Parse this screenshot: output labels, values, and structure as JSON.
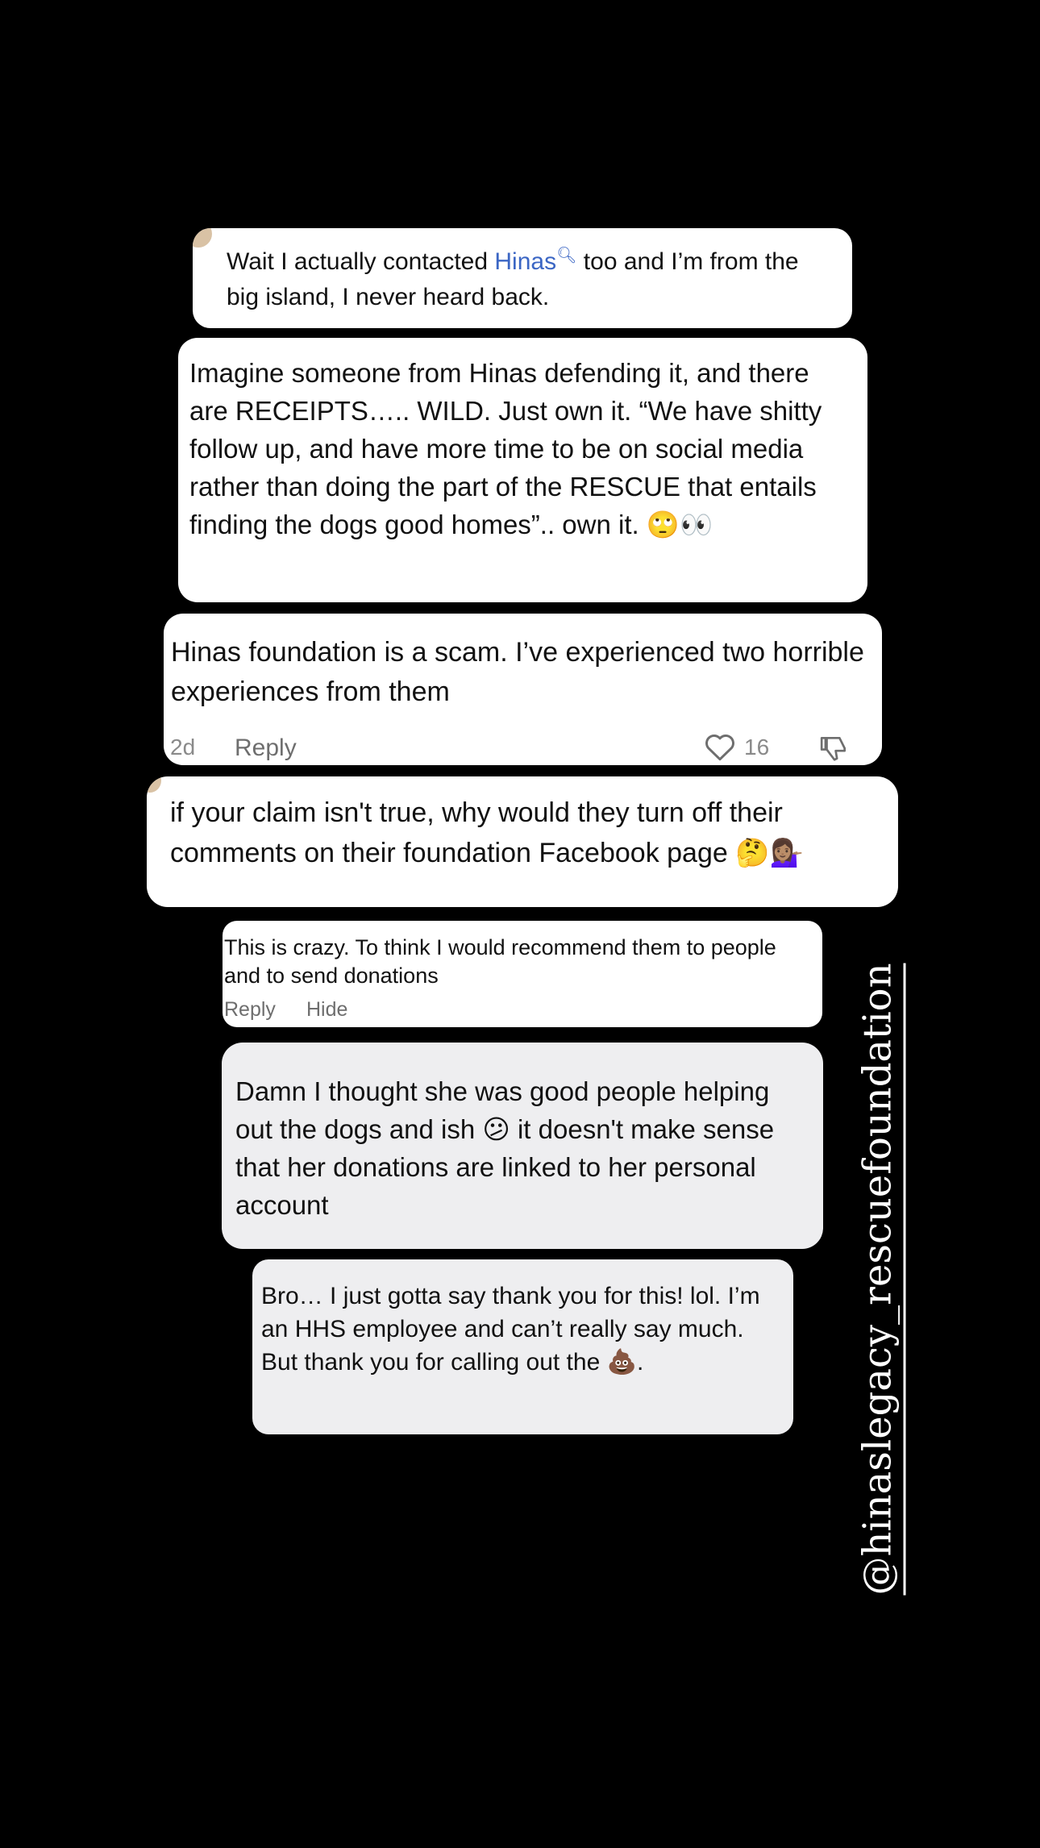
{
  "comments": [
    {
      "id": "c1",
      "text_before": "Wait I actually contacted ",
      "link": "Hinas",
      "text_after": " too and I’m from the big island, I never heard back."
    },
    {
      "id": "c2",
      "text": "Imagine someone from Hinas defending it, and there are RECEIPTS….. WILD. Just own it. “We have shitty follow up, and have more time to be on social media rather than doing the part of the RESCUE that entails finding the dogs good homes”.. own it. 🙄👀"
    },
    {
      "id": "c3",
      "text": "Hinas foundation is a scam. I’ve experienced two horrible experiences from them",
      "age": "2d",
      "reply_label": "Reply",
      "like_count": "16"
    },
    {
      "id": "c4",
      "text": "if your claim isn't true, why would they turn off their comments on their foundation Facebook page 🤔💁🏽‍♀️"
    },
    {
      "id": "c5",
      "text": "This is crazy. To think I would recommend them to people and to send donations",
      "reply_label": "Reply",
      "hide_label": "Hide"
    },
    {
      "id": "c6",
      "text": "Damn I thought she was good people helping out the dogs and ish 😕 it doesn't make sense that her donations are linked to her personal account"
    },
    {
      "id": "c7",
      "text": "Bro… I just gotta say thank you for this! lol. I’m an HHS employee and can’t really say much. But thank you for calling out the 💩."
    }
  ],
  "overlay_handle": "@hinaslegacy_rescuefoundation",
  "colors": {
    "background": "#000000",
    "card": "#ffffff",
    "card_gray": "#eeeef0",
    "link": "#3b66c4",
    "meta": "#8a8a8a"
  }
}
